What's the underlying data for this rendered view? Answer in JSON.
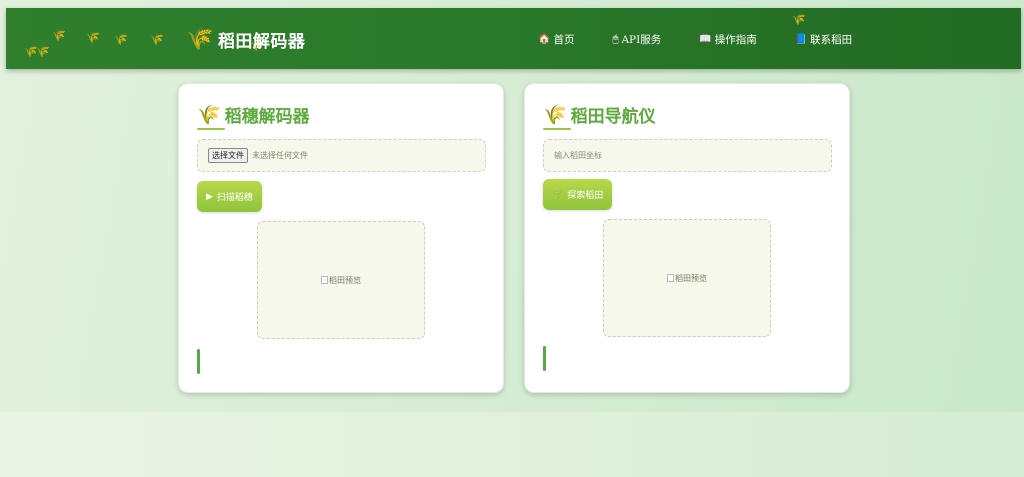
{
  "header": {
    "brand": "稻田解码器",
    "nav": [
      {
        "icon": "🏠",
        "label": "首页"
      },
      {
        "icon": "🖱",
        "label": "API服务"
      },
      {
        "icon": "📖",
        "label": "操作指南"
      },
      {
        "icon": "📘",
        "label": "联系稻田"
      }
    ]
  },
  "left_card": {
    "title": "稻穗解码器",
    "file_button": "选择文件",
    "file_status": "未选择任何文件",
    "action_icon": "▶",
    "action_label": "扫描稻穗",
    "preview_alt": "稻田预览"
  },
  "right_card": {
    "title": "稻田导航仪",
    "input_placeholder": "输入稻田坐标",
    "action_icon": "🌱",
    "action_label": "探索稻田",
    "preview_alt": "稻田预览"
  },
  "colors": {
    "header": "#2b7a2b",
    "accent": "#5eaa3e",
    "button": "#9fcc42"
  }
}
